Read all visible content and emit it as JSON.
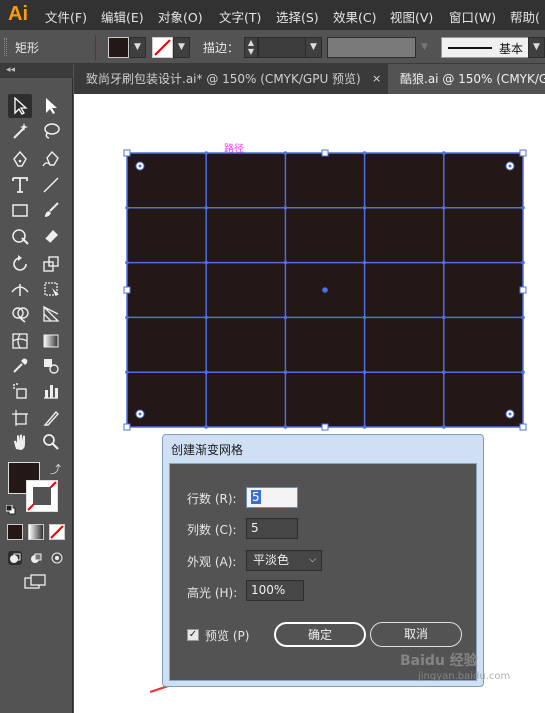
{
  "app": {
    "logo": "Ai"
  },
  "menu": [
    "文件(F)",
    "编辑(E)",
    "对象(O)",
    "文字(T)",
    "选择(S)",
    "效果(C)",
    "视图(V)",
    "窗口(W)",
    "帮助("
  ],
  "control_bar": {
    "object_type": "矩形",
    "stroke_label": "描边：",
    "brush_label": "基本",
    "fill_color": "#231815"
  },
  "toolbar": {
    "collapse": "◂◂"
  },
  "tabs": [
    {
      "title": "致尚牙刷包装设计.ai* @ 150% (CMYK/GPU 预览)",
      "close": "×",
      "active": false
    },
    {
      "title": "酷狼.ai @ 150% (CMYK/G",
      "active": true
    }
  ],
  "canvas": {
    "path_label": "路径",
    "mesh_fill": "#231815",
    "mesh_line_color": "#4f6fe0",
    "annotation_color": "#ee3333"
  },
  "dialog": {
    "title": "创建渐变网格",
    "rows_label": "行数 (R):",
    "rows_value": "5",
    "cols_label": "列数 (C):",
    "cols_value": "5",
    "appearance_label": "外观 (A):",
    "appearance_value": "平淡色",
    "highlight_label": "高光 (H):",
    "highlight_value": "100%",
    "preview_label": "预览 (P)",
    "preview_checked": true,
    "ok_label": "确定",
    "cancel_label": "取消"
  },
  "watermark": {
    "brand": "Baidu 经验",
    "url": "jingyan.baidu.com"
  }
}
